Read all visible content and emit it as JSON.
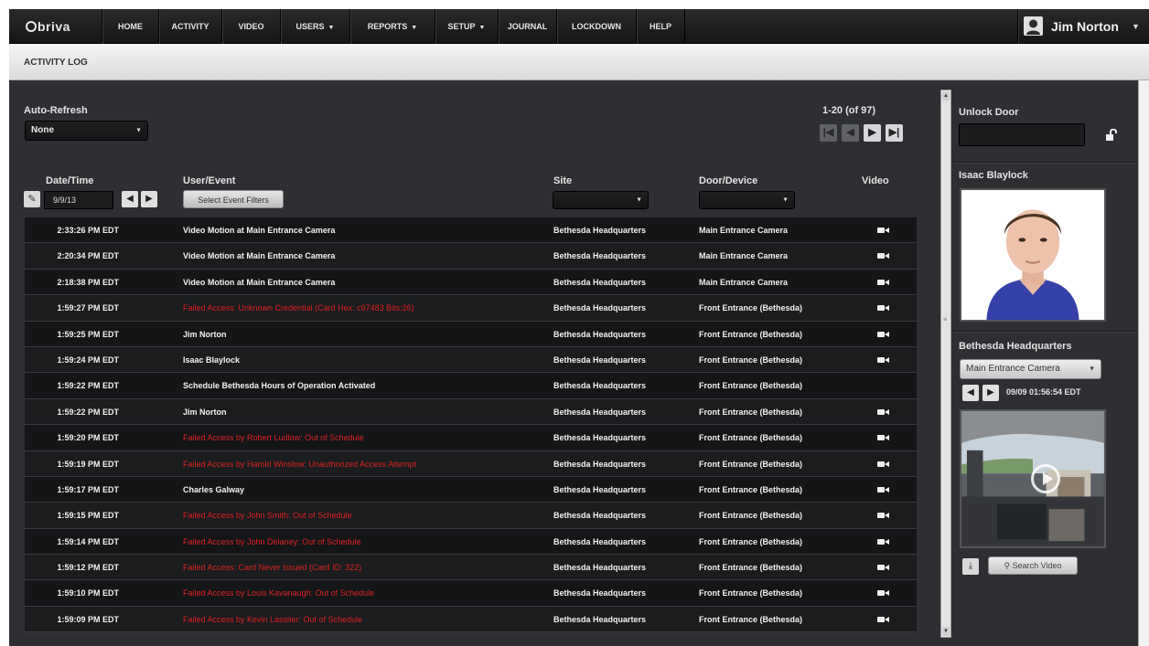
{
  "brand": {
    "logo_text": "briva"
  },
  "nav": {
    "items": [
      {
        "label": "HOME"
      },
      {
        "label": "ACTIVITY"
      },
      {
        "label": "VIDEO"
      },
      {
        "label": "USERS"
      },
      {
        "label": "REPORTS"
      },
      {
        "label": "SETUP"
      },
      {
        "label": "JOURNAL"
      },
      {
        "label": "LOCKDOWN"
      },
      {
        "label": "HELP"
      }
    ],
    "user_name": "Jim Norton"
  },
  "page_title": "ACTIVITY LOG",
  "auto_refresh": {
    "label": "Auto-Refresh",
    "value": "None"
  },
  "pager": {
    "range_text": "1-20 (of 97)"
  },
  "columns": {
    "datetime": "Date/Time",
    "user_event": "User/Event",
    "site": "Site",
    "door_device": "Door/Device",
    "video": "Video"
  },
  "filters": {
    "date_value": "9/9/13",
    "event_filter_button": "Select Event Filters"
  },
  "rows": [
    {
      "time": "2:33:26 PM EDT",
      "event": "Video Motion at Main Entrance Camera",
      "failed": false,
      "site": "Bethesda Headquarters",
      "door": "Main Entrance Camera",
      "video": true
    },
    {
      "time": "2:20:34 PM EDT",
      "event": "Video Motion at Main Entrance Camera",
      "failed": false,
      "site": "Bethesda Headquarters",
      "door": "Main Entrance Camera",
      "video": true
    },
    {
      "time": "2:18:38 PM EDT",
      "event": "Video Motion at Main Entrance Camera",
      "failed": false,
      "site": "Bethesda Headquarters",
      "door": "Main Entrance Camera",
      "video": true
    },
    {
      "time": "1:59:27 PM EDT",
      "event": "Failed Access: Unknown Credential (Card Hex: c97483 Bits:26)",
      "failed": true,
      "site": "Bethesda Headquarters",
      "door": "Front Entrance (Bethesda)",
      "video": true
    },
    {
      "time": "1:59:25 PM EDT",
      "event": "Jim Norton",
      "failed": false,
      "site": "Bethesda Headquarters",
      "door": "Front Entrance (Bethesda)",
      "video": true
    },
    {
      "time": "1:59:24 PM EDT",
      "event": "Isaac Blaylock",
      "failed": false,
      "site": "Bethesda Headquarters",
      "door": "Front Entrance (Bethesda)",
      "video": true
    },
    {
      "time": "1:59:22 PM EDT",
      "event": "Schedule Bethesda Hours of Operation Activated",
      "failed": false,
      "site": "Bethesda Headquarters",
      "door": "Front Entrance (Bethesda)",
      "video": false
    },
    {
      "time": "1:59:22 PM EDT",
      "event": "Jim Norton",
      "failed": false,
      "site": "Bethesda Headquarters",
      "door": "Front Entrance (Bethesda)",
      "video": true
    },
    {
      "time": "1:59:20 PM EDT",
      "event": "Failed Access by Robert Ludlow: Out of Schedule",
      "failed": true,
      "site": "Bethesda Headquarters",
      "door": "Front Entrance (Bethesda)",
      "video": true
    },
    {
      "time": "1:59:19 PM EDT",
      "event": "Failed Access by Harold Winslow: Unauthorized Access Attempt",
      "failed": true,
      "site": "Bethesda Headquarters",
      "door": "Front Entrance (Bethesda)",
      "video": true
    },
    {
      "time": "1:59:17 PM EDT",
      "event": "Charles Galway",
      "failed": false,
      "site": "Bethesda Headquarters",
      "door": "Front Entrance (Bethesda)",
      "video": true
    },
    {
      "time": "1:59:15 PM EDT",
      "event": "Failed Access by John Smith: Out of Schedule",
      "failed": true,
      "site": "Bethesda Headquarters",
      "door": "Front Entrance (Bethesda)",
      "video": true
    },
    {
      "time": "1:59:14 PM EDT",
      "event": "Failed Access by John Delaney: Out of Schedule",
      "failed": true,
      "site": "Bethesda Headquarters",
      "door": "Front Entrance (Bethesda)",
      "video": true
    },
    {
      "time": "1:59:12 PM EDT",
      "event": "Failed Access: Card Never Issued (Card ID: 322)",
      "failed": true,
      "site": "Bethesda Headquarters",
      "door": "Front Entrance (Bethesda)",
      "video": true
    },
    {
      "time": "1:59:10 PM EDT",
      "event": "Failed Access by Louis Kavanaugh: Out of Schedule",
      "failed": true,
      "site": "Bethesda Headquarters",
      "door": "Front Entrance (Bethesda)",
      "video": true
    },
    {
      "time": "1:59:09 PM EDT",
      "event": "Failed Access by Kevin Lassiter: Out of Schedule",
      "failed": true,
      "site": "Bethesda Headquarters",
      "door": "Front Entrance (Bethesda)",
      "video": true
    }
  ],
  "right_panel": {
    "unlock_door_label": "Unlock Door",
    "person_name": "Isaac Blaylock",
    "site_name": "Bethesda Headquarters",
    "camera_select": "Main Entrance Camera",
    "video_timestamp": "09/09 01:56:54 EDT",
    "search_video_button": "Search Video"
  },
  "icons": [
    "user-icon",
    "wrench-icon",
    "camera-icon",
    "lock-icon",
    "play-icon",
    "download-icon",
    "search-icon"
  ],
  "colors": {
    "failed_event": "#dd2222",
    "nav_bg": "#1c1c1e",
    "main_bg": "#2e2f32"
  }
}
